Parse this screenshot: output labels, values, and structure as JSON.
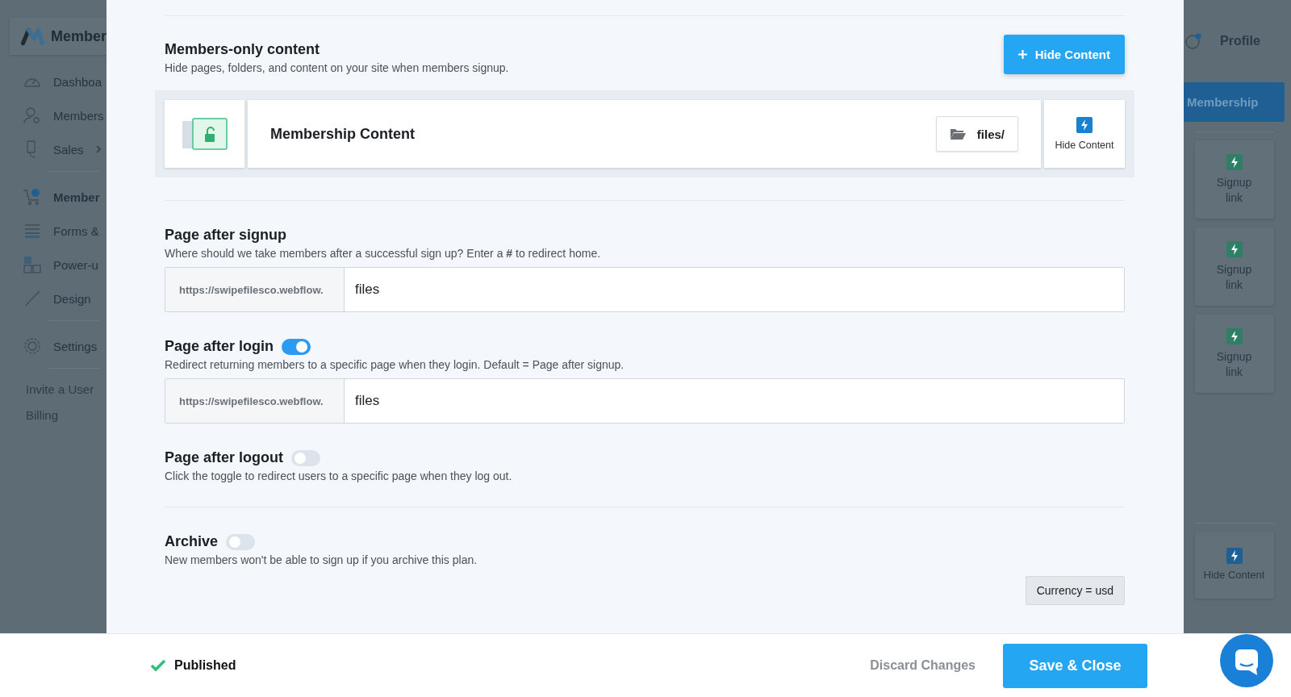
{
  "sidebar": {
    "logo_text": "Member",
    "items": [
      {
        "label": "Dashboa",
        "selected": false,
        "has_submenu": false
      },
      {
        "label": "Members",
        "selected": false,
        "has_submenu": false
      },
      {
        "label": "Sales",
        "selected": false,
        "has_submenu": true
      },
      {
        "label": "Member",
        "selected": true,
        "has_submenu": false
      },
      {
        "label": "Forms &",
        "selected": false,
        "has_submenu": false
      },
      {
        "label": "Power-u",
        "selected": false,
        "has_submenu": false
      },
      {
        "label": "Design",
        "selected": false,
        "has_submenu": false
      },
      {
        "label": "Settings",
        "selected": false,
        "has_submenu": false
      }
    ],
    "links": [
      "Invite a User",
      "Billing"
    ]
  },
  "header": {
    "profile": "Profile"
  },
  "right_panel": {
    "tab": "Membership",
    "cards": [
      {
        "label": "Signup link",
        "color": "#2f7f66"
      },
      {
        "label": "Signup link",
        "color": "#2f7f66"
      },
      {
        "label": "Signup link",
        "color": "#2f7f66"
      },
      {
        "label": "Hide Content",
        "color": "#1f5f93"
      }
    ]
  },
  "modal": {
    "members_only": {
      "title": "Members-only content",
      "description": "Hide pages, folders, and content on your site when members signup.",
      "button": "Hide Content",
      "item": {
        "title": "Membership Content",
        "path": "files/",
        "action": "Hide Content"
      }
    },
    "sections": [
      {
        "title": "Page after signup",
        "description": "Where should we take members after a successful sign up? Enter a **#** to redirect home.",
        "input": {
          "prefix": "https://swipefilesco.webflow.",
          "value": "files"
        }
      },
      {
        "title": "Page after login",
        "on": true,
        "description": "Redirect returning members to a specific page when they login. Default = Page after signup.",
        "input": {
          "prefix": "https://swipefilesco.webflow.",
          "value": "files"
        }
      },
      {
        "title": "Page after logout",
        "on": false,
        "description": "Click the toggle to redirect users to a specific page when they log out."
      }
    ],
    "archive": {
      "title": "Archive",
      "on": false,
      "description": "New members won't be able to sign up if you archive this plan."
    },
    "currency": "Currency = usd"
  },
  "footer": {
    "status": "Published",
    "discard": "Discard Changes",
    "save": "Save & Close"
  }
}
